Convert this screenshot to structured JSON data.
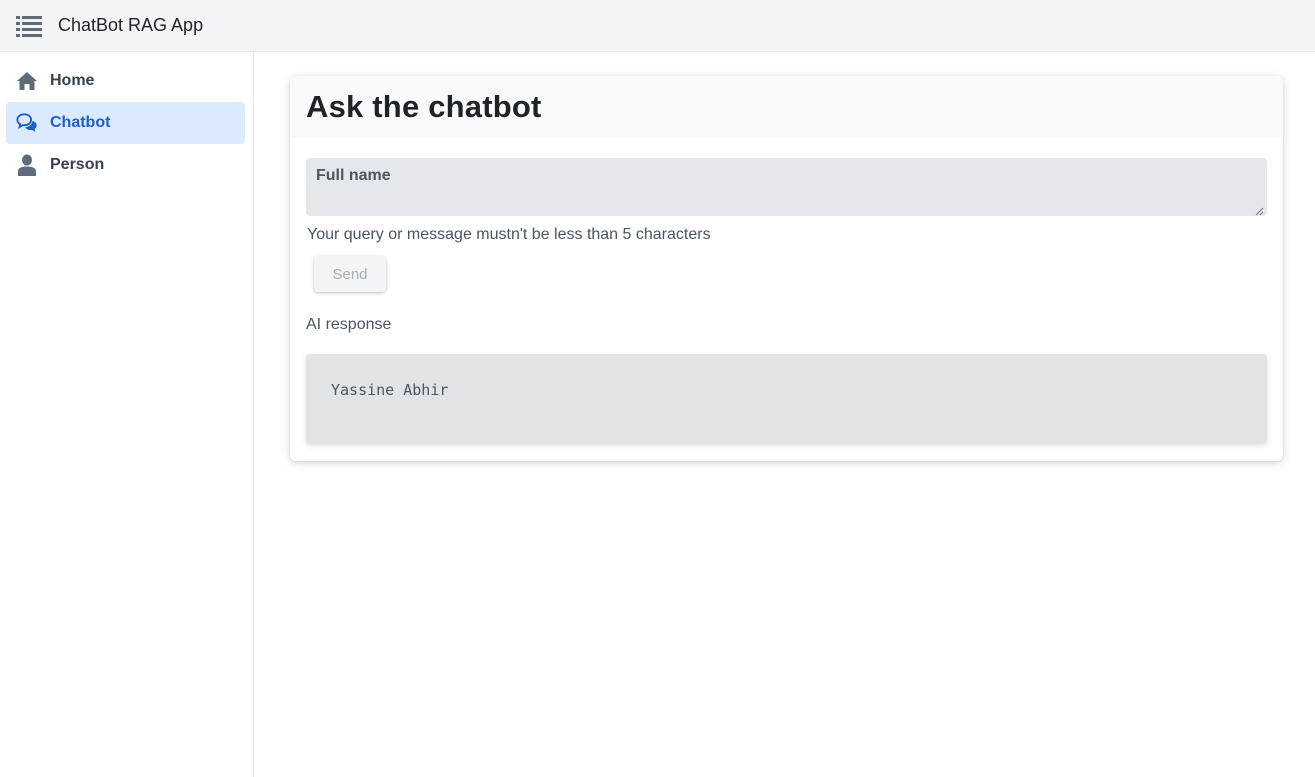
{
  "app": {
    "title": "ChatBot RAG App",
    "menu_icon": "list-menu-icon"
  },
  "sidebar": {
    "items": [
      {
        "label": "Home",
        "icon": "home-icon",
        "active": false
      },
      {
        "label": "Chatbot",
        "icon": "chat-bubbles-icon",
        "active": true
      },
      {
        "label": "Person",
        "icon": "person-icon",
        "active": false
      }
    ]
  },
  "main": {
    "card_title": "Ask the chatbot",
    "query_input": {
      "placeholder": "Full name",
      "value": ""
    },
    "hint": "Your query or message mustn't be less than 5 characters",
    "send_label": "Send",
    "send_disabled": true,
    "response_label": "AI response",
    "response_text": "Yassine Abhir"
  },
  "colors": {
    "accent": "#1d5fc9",
    "active_bg": "#dbeafe",
    "topbar_bg": "#f3f4f6"
  }
}
